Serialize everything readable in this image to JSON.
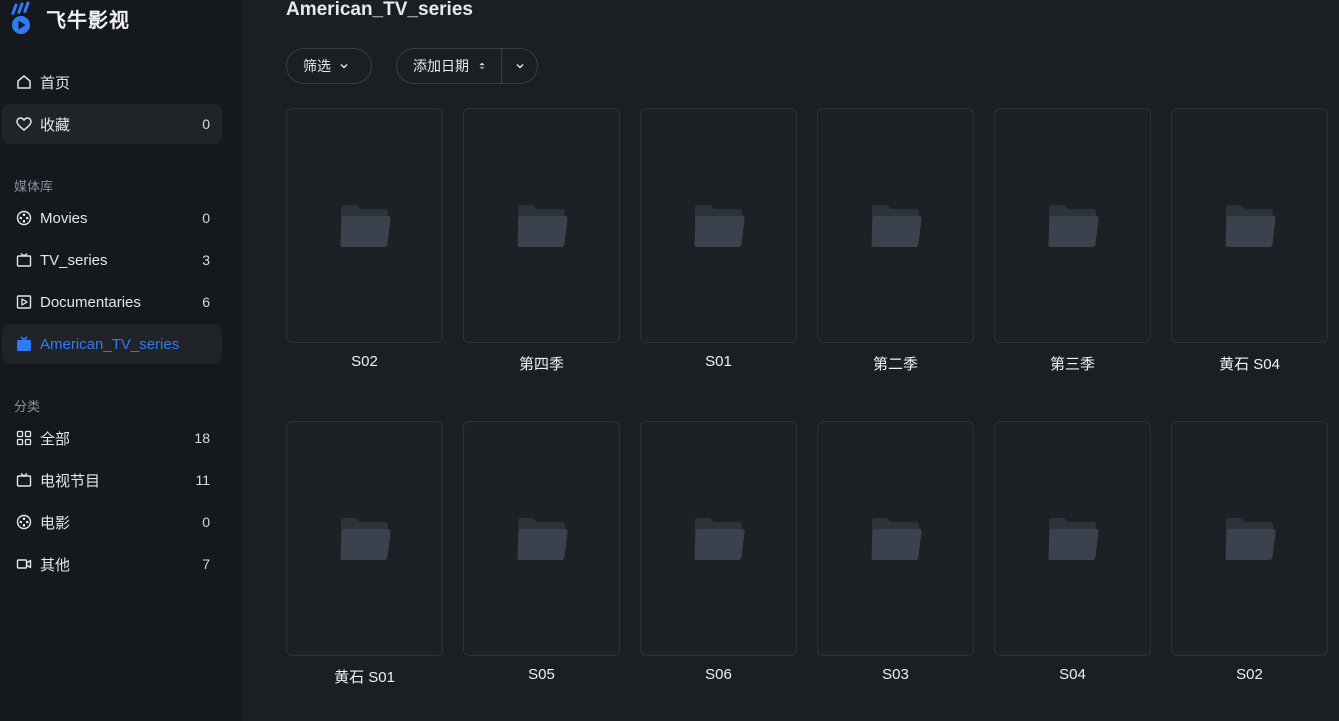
{
  "app": {
    "name": "飞牛影视"
  },
  "colors": {
    "accent": "#2d7cf6",
    "sidebar_bg": "#15181c",
    "main_bg": "#1b1e23"
  },
  "sidebar": {
    "top_items": [
      {
        "label": "首页",
        "icon": "home-icon",
        "count": ""
      },
      {
        "label": "收藏",
        "icon": "heart-icon",
        "count": "0"
      }
    ],
    "library_title": "媒体库",
    "libraries": [
      {
        "label": "Movies",
        "icon": "film-reel-icon",
        "count": "0"
      },
      {
        "label": "TV_series",
        "icon": "tv-icon",
        "count": "3"
      },
      {
        "label": "Documentaries",
        "icon": "play-box-icon",
        "count": "6"
      },
      {
        "label": "American_TV_series",
        "icon": "tv-filled-icon",
        "count": ""
      }
    ],
    "category_title": "分类",
    "categories": [
      {
        "label": "全部",
        "icon": "grid-icon",
        "count": "18"
      },
      {
        "label": "电视节目",
        "icon": "tv-icon",
        "count": "11"
      },
      {
        "label": "电影",
        "icon": "film-reel-icon",
        "count": "0"
      },
      {
        "label": "其他",
        "icon": "video-camera-icon",
        "count": "7"
      }
    ]
  },
  "main": {
    "title": "American_TV_series",
    "filter_label": "筛选",
    "sort_label": "添加日期",
    "items": [
      {
        "label": "S02"
      },
      {
        "label": "第四季"
      },
      {
        "label": "S01"
      },
      {
        "label": "第二季"
      },
      {
        "label": "第三季"
      },
      {
        "label": "黄石 S04"
      },
      {
        "label": "黄石 S01"
      },
      {
        "label": "S05"
      },
      {
        "label": "S06"
      },
      {
        "label": "S03"
      },
      {
        "label": "S04"
      },
      {
        "label": "S02"
      }
    ]
  }
}
